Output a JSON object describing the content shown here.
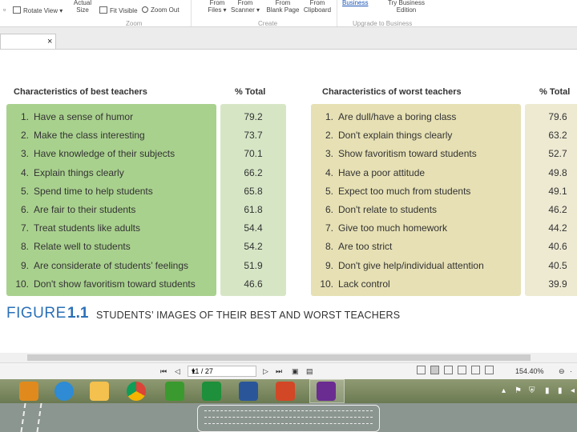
{
  "ribbon": {
    "rotate_view": "Rotate View",
    "actual_size_line1": "Actual",
    "actual_size_line2": "Size",
    "fit_visible": "Fit Visible",
    "zoom_out": "Zoom Out",
    "zoom_group": "Zoom",
    "from_files_line1": "From",
    "from_files_line2": "Files",
    "from_scanner_line1": "From",
    "from_scanner_line2": "Scanner",
    "from_blank_line1": "From",
    "from_blank_line2": "Blank Page",
    "from_clipboard_line1": "From",
    "from_clipboard_line2": "Clipboard",
    "create_group": "Create",
    "business_link": "Business",
    "try_business_line1": "Try Business",
    "try_business_line2": "Edition",
    "upgrade_group": "Upgrade to Business"
  },
  "tab": {
    "close_glyph": "×"
  },
  "document": {
    "best_header": "Characteristics of best teachers",
    "best_total_header": "% Total",
    "worst_header": "Characteristics of worst teachers",
    "worst_total_header": "% Total",
    "best": [
      {
        "num": "1.",
        "text": "Have a sense of humor",
        "total": "79.2"
      },
      {
        "num": "2.",
        "text": "Make the class interesting",
        "total": "73.7"
      },
      {
        "num": "3.",
        "text": "Have knowledge of their subjects",
        "total": "70.1"
      },
      {
        "num": "4.",
        "text": "Explain things clearly",
        "total": "66.2"
      },
      {
        "num": "5.",
        "text": "Spend time to help students",
        "total": "65.8"
      },
      {
        "num": "6.",
        "text": "Are fair to their students",
        "total": "61.8"
      },
      {
        "num": "7.",
        "text": "Treat students like adults",
        "total": "54.4"
      },
      {
        "num": "8.",
        "text": "Relate well to students",
        "total": "54.2"
      },
      {
        "num": "9.",
        "text": "Are considerate of students’ feelings",
        "total": "51.9"
      },
      {
        "num": "10.",
        "text": "Don't show favoritism toward students",
        "total": "46.6"
      }
    ],
    "worst": [
      {
        "num": "1.",
        "text": "Are dull/have a boring class",
        "total": "79.6"
      },
      {
        "num": "2.",
        "text": "Don't explain things clearly",
        "total": "63.2"
      },
      {
        "num": "3.",
        "text": "Show favoritism toward students",
        "total": "52.7"
      },
      {
        "num": "4.",
        "text": "Have a poor attitude",
        "total": "49.8"
      },
      {
        "num": "5.",
        "text": "Expect too much from students",
        "total": "49.1"
      },
      {
        "num": "6.",
        "text": "Don't relate to students",
        "total": "46.2"
      },
      {
        "num": "7.",
        "text": "Give too much homework",
        "total": "44.2"
      },
      {
        "num": "8.",
        "text": "Are too strict",
        "total": "40.6"
      },
      {
        "num": "9.",
        "text": "Don't give help/individual attention",
        "total": "40.5"
      },
      {
        "num": "10.",
        "text": "Lack control",
        "total": "39.9"
      }
    ],
    "figure_word": "FIGURE",
    "figure_number": "1.1",
    "figure_caption": "STUDENTS’ IMAGES OF THEIR BEST AND WORST TEACHERS"
  },
  "status": {
    "page_value": "11 / 27",
    "zoom": "154.40%"
  },
  "colors": {
    "best_panel": "#a9d18e",
    "best_total_panel": "#d6e6c5",
    "worst_panel": "#e6e0b4",
    "worst_total_panel": "#eeead2",
    "figure_blue": "#2b70b8"
  },
  "taskbar_icons": [
    "app-orange-icon",
    "qb-icon",
    "search-app-icon",
    "chrome-icon",
    "cloud-app-icon",
    "store-icon",
    "word-icon",
    "powerpoint-icon",
    "pdf-icon"
  ]
}
